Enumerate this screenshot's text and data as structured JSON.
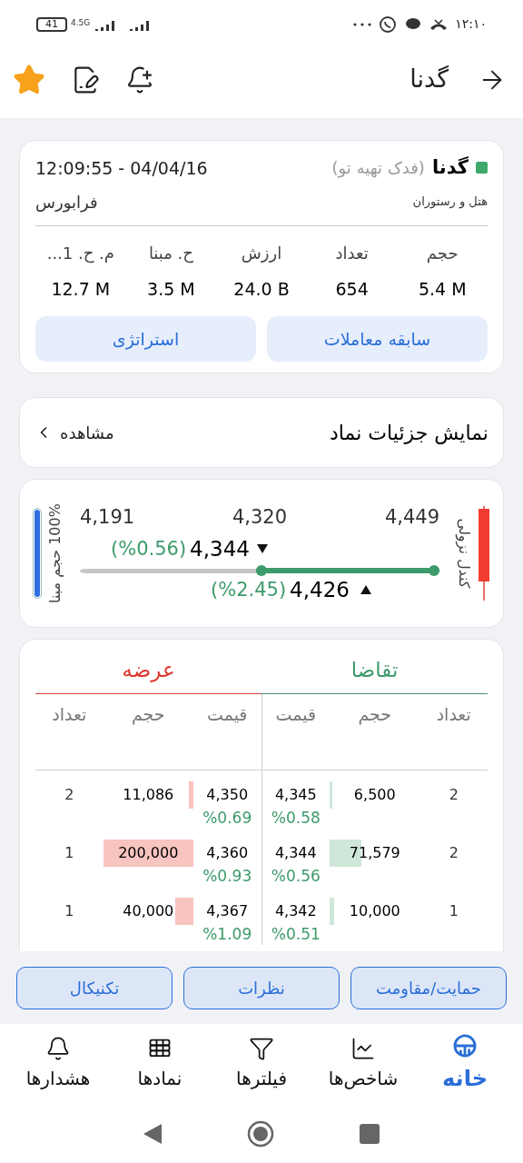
{
  "status_bar": {
    "time": "۱۲:۱۰",
    "battery": "41",
    "network": "4.5G"
  },
  "header": {
    "title": "گدنا",
    "favorite": true
  },
  "summary": {
    "symbol": "گدنا",
    "color": "#3daa6b",
    "company": "(فدک تهیه تو)",
    "timestamp": "12:09:55 - 04/04/16",
    "industry": "هتل و رستوران",
    "market": "فرابورس",
    "stats": [
      {
        "label": "حجم",
        "value": "5.4 M"
      },
      {
        "label": "تعداد",
        "value": "654"
      },
      {
        "label": "ارزش",
        "value": "24.0 B"
      },
      {
        "label": "ح. مبنا",
        "value": "3.5 M"
      },
      {
        "label": "م. ح. 1...",
        "value": "12.7 M"
      }
    ],
    "buttons": [
      "سابقه معاملات",
      "استراتژی"
    ]
  },
  "details": {
    "title": "نمایش جزئیات نماد",
    "action": "مشاهده"
  },
  "price_range": {
    "candle_label": "کندل نزولی",
    "high": "4,449",
    "mid": "4,320",
    "low": "4,191",
    "last": {
      "value": "4,344",
      "change": "(%0.56)"
    },
    "close": {
      "value": "4,426",
      "change": "(%2.45)"
    },
    "level": 0.51,
    "volume_label": "100% حجم مبنا"
  },
  "order_book": {
    "bid_title": "تقاضا",
    "ask_title": "عرضه",
    "bid_columns": [
      "تعداد",
      "حجم",
      "قیمت"
    ],
    "ask_columns": [
      "قیمت",
      "حجم",
      "تعداد"
    ],
    "rows": [
      {
        "bid": {
          "count": "2",
          "volume": "6,500",
          "price": "4,345",
          "change": "%0.58"
        },
        "ask": {
          "count": "2",
          "volume": "11,086",
          "price": "4,350",
          "change": "%0.69"
        }
      },
      {
        "bid": {
          "count": "2",
          "volume": "71,579",
          "price": "4,344",
          "change": "%0.56"
        },
        "ask": {
          "count": "1",
          "volume": "200,000",
          "price": "4,360",
          "change": "%0.93"
        }
      },
      {
        "bid": {
          "count": "1",
          "volume": "10,000",
          "price": "4,342",
          "change": "%0.51"
        },
        "ask": {
          "count": "1",
          "volume": "40,000",
          "price": "4,367",
          "change": "%1.09"
        }
      }
    ]
  },
  "tools": [
    "حمایت/مقاومت",
    "نظرات",
    "تکنیکال"
  ],
  "nav": [
    {
      "label": "خانه",
      "kind": "home",
      "selected": true
    },
    {
      "label": "شاخص‌ها",
      "kind": "indices",
      "selected": false
    },
    {
      "label": "فیلترها",
      "kind": "filters",
      "selected": false
    },
    {
      "label": "نمادها",
      "kind": "symbols",
      "selected": false
    },
    {
      "label": "هشدارها",
      "kind": "alerts",
      "selected": false
    }
  ]
}
